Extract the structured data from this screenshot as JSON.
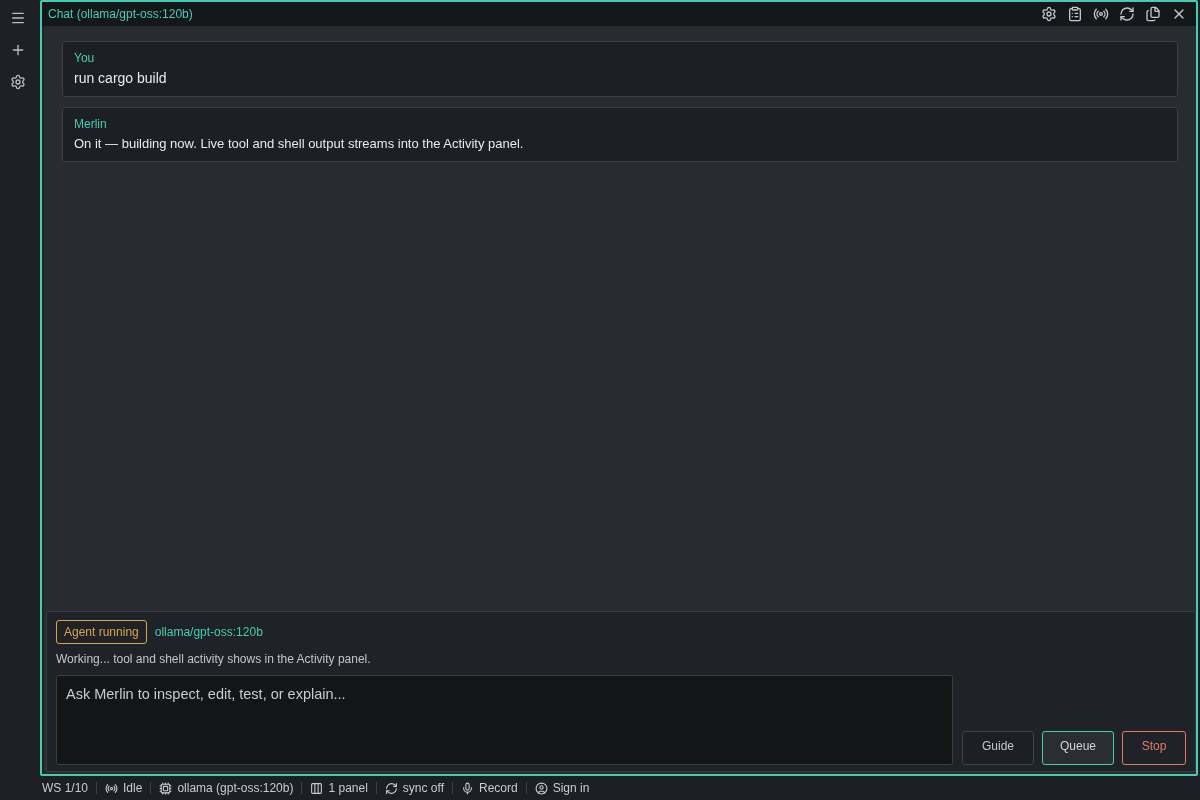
{
  "panel": {
    "title": "Chat (ollama/gpt-oss:120b)"
  },
  "messages": [
    {
      "author": "You",
      "text": "run cargo build"
    },
    {
      "author": "Merlin",
      "text": "On it — building now. Live tool and shell output streams into the Activity panel."
    }
  ],
  "composer": {
    "status_badge": {
      "label": "Agent running",
      "kind": "running"
    },
    "model": "ollama/gpt-oss:120b",
    "hint": "Working... tool and shell activity shows in the Activity panel.",
    "input": {
      "placeholder": "Ask Merlin to inspect, edit, test, or explain..."
    },
    "buttons": [
      {
        "label": "Guide",
        "kind": "plain"
      },
      {
        "label": "Queue",
        "kind": "primary"
      },
      {
        "label": "Stop",
        "kind": "danger"
      }
    ]
  },
  "status_bar": [
    {
      "kind": "workspace",
      "text": "WS 1/10"
    },
    {
      "kind": "connection",
      "text": "Idle"
    },
    {
      "kind": "model",
      "text": "ollama (gpt-oss:120b)"
    },
    {
      "kind": "layout",
      "text": "1 panel"
    },
    {
      "kind": "sync",
      "text": "sync off"
    },
    {
      "kind": "record",
      "text": "Record"
    },
    {
      "kind": "account",
      "text": "Sign in"
    }
  ]
}
